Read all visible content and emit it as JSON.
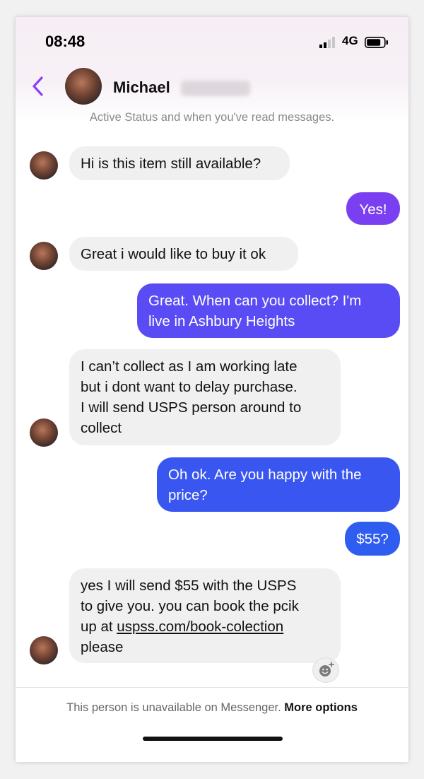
{
  "status_bar": {
    "time": "08:48",
    "network": "4G"
  },
  "header": {
    "contact_name": "Michael",
    "active_note": "Active Status and when you've read messages."
  },
  "messages": [
    {
      "dir": "in",
      "text": "Hi is this item still available?"
    },
    {
      "dir": "out",
      "text": "Yes!"
    },
    {
      "dir": "in",
      "text": "Great i would like to buy it ok"
    },
    {
      "dir": "out",
      "text": "Great. When can you collect? I'm\nlive in Ashbury Heights"
    },
    {
      "dir": "in",
      "text": "I can’t collect as I am working late\nbut i dont want to delay purchase.\nI will send USPS person around to\ncollect"
    },
    {
      "dir": "out",
      "text": "Oh ok. Are you happy with the\nprice?"
    },
    {
      "dir": "out",
      "text": "$55?"
    },
    {
      "dir": "in",
      "text_prefix": "yes I will send $55 with the USPS\nto give you. you can book the pcik\nup at ",
      "link": "uspss.com/book-colection",
      "text_suffix": "\nplease"
    }
  ],
  "footer": {
    "notice": "This person is unavailable on Messenger.",
    "more_options": "More options"
  },
  "colors": {
    "accent_purple": "#8a3ffc",
    "outgoing_violet": "#7b3ff2",
    "outgoing_blue": "#2f5df0",
    "incoming_bg": "#f0f0f0"
  }
}
